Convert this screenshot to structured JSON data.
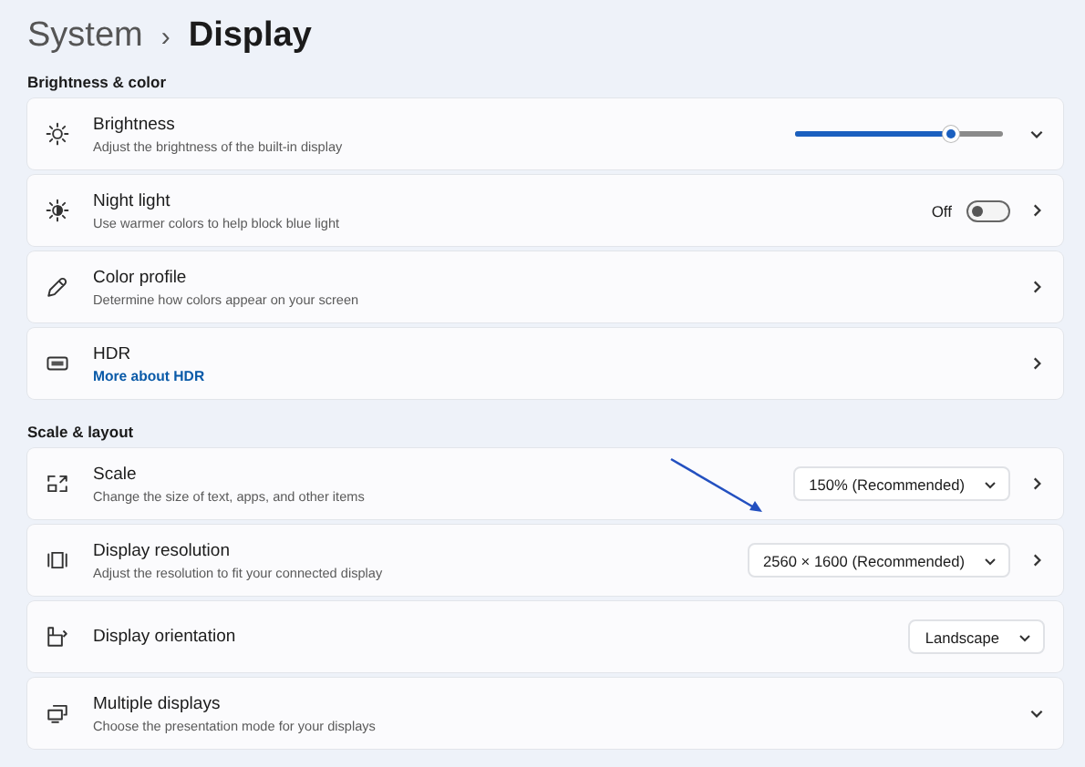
{
  "breadcrumb": {
    "parent": "System",
    "separator": "›",
    "current": "Display"
  },
  "sections": [
    {
      "title": "Brightness & color",
      "rows": [
        {
          "kind": "expander",
          "title": "Brightness",
          "subtitle": "Adjust the brightness of the built-in display",
          "control": {
            "kind": "slider",
            "level": 0.75
          }
        },
        {
          "kind": "link",
          "title": "Night light",
          "subtitle": "Use warmer colors to help block blue light",
          "control": {
            "kind": "toggle",
            "label": "Off",
            "on": false
          }
        },
        {
          "kind": "link",
          "title": "Color profile",
          "subtitle": "Determine how colors appear on your screen"
        },
        {
          "kind": "link",
          "title": "HDR",
          "link": "More about HDR"
        }
      ]
    },
    {
      "title": "Scale & layout",
      "rows": [
        {
          "kind": "link",
          "title": "Scale",
          "subtitle": "Change the size of text, apps, and other items",
          "control": {
            "kind": "dropdown",
            "value": "150% (Recommended)"
          },
          "annotated": true
        },
        {
          "kind": "link",
          "title": "Display resolution",
          "subtitle": "Adjust the resolution to fit your connected display",
          "control": {
            "kind": "dropdown",
            "value": "2560 × 1600 (Recommended)"
          }
        },
        {
          "kind": "plain",
          "title": "Display orientation",
          "control": {
            "kind": "dropdown",
            "value": "Landscape"
          }
        },
        {
          "kind": "expander",
          "title": "Multiple displays",
          "subtitle": "Choose the presentation mode for your displays"
        }
      ]
    }
  ]
}
